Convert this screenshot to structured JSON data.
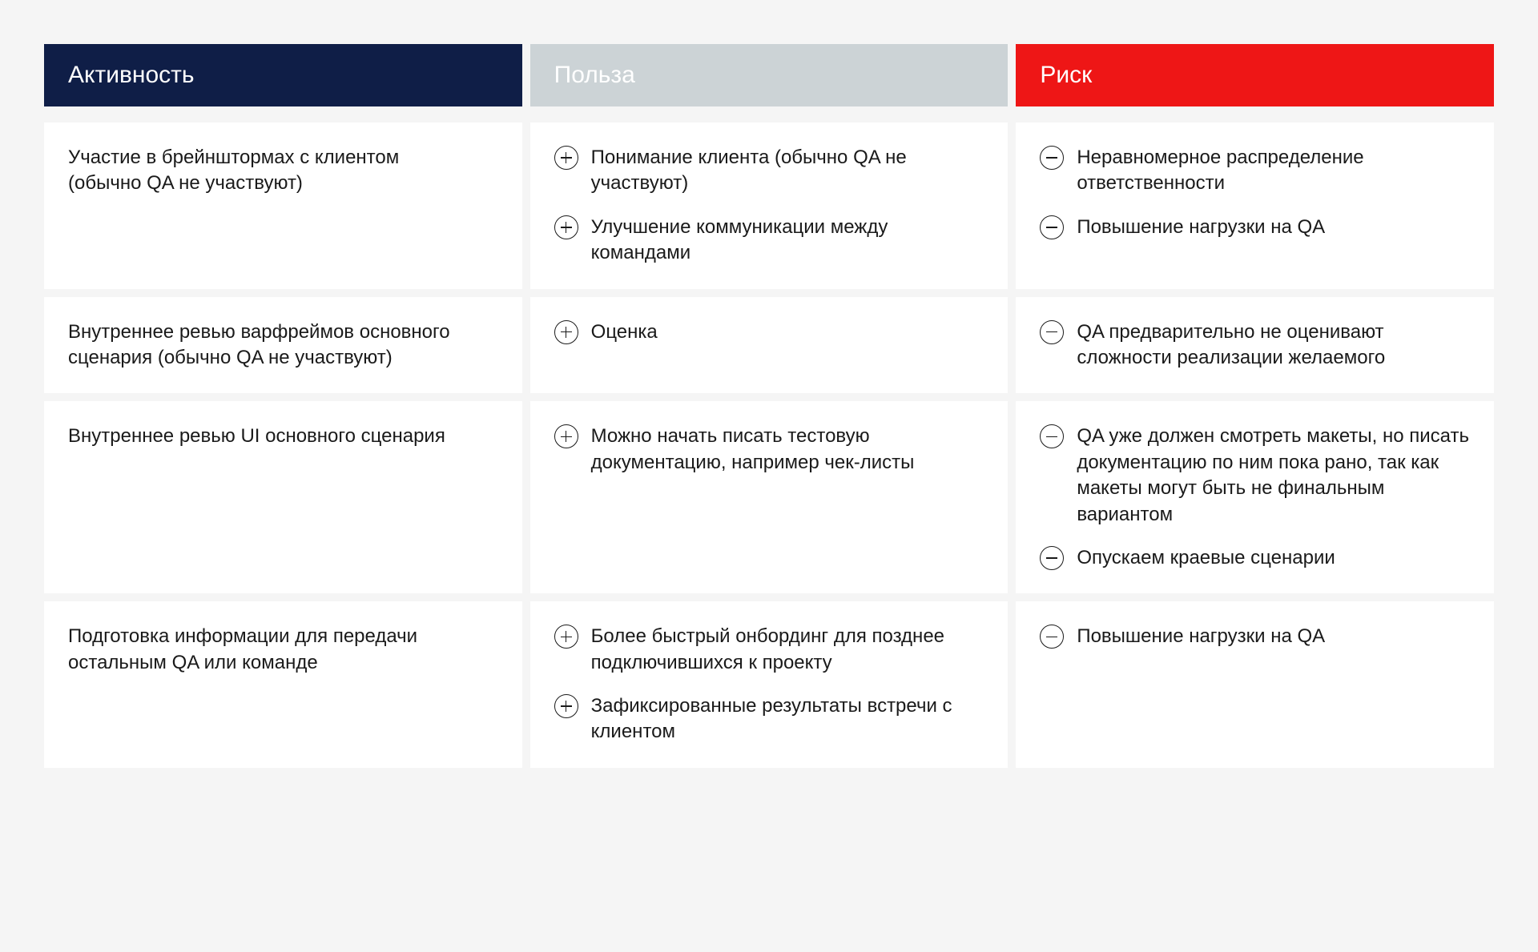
{
  "headers": {
    "activity": "Активность",
    "benefit": "Польза",
    "risk": "Риск"
  },
  "rows": [
    {
      "activity": "Участие в брейнштормах с клиентом (обычно QA не участвуют)",
      "benefits": [
        "Понимание клиента (обычно QA не участвуют)",
        "Улучшение коммуникации между командами"
      ],
      "risks": [
        "Неравномерное распределение ответственности",
        "Повышение нагрузки на QA"
      ]
    },
    {
      "activity": "Внутреннее ревью варфреймов основного сценария (обычно QA не участвуют)",
      "benefits": [
        "Оценка"
      ],
      "risks": [
        "QA предварительно не оценивают сложности реализации желаемого"
      ]
    },
    {
      "activity": "Внутреннее ревью UI основного сценария",
      "benefits": [
        "Можно начать писать тестовую документацию, например чек-листы"
      ],
      "risks": [
        "QA уже должен смотреть макеты, но писать документацию по ним пока рано, так как макеты могут быть не финальным вариантом",
        "Опускаем краевые сценарии"
      ]
    },
    {
      "activity": "Подготовка информации для передачи остальным QA или команде",
      "benefits": [
        "Более быстрый онбординг для позднее подключившихся к проекту",
        "Зафиксированные результаты встречи с клиентом"
      ],
      "risks": [
        "Повышение нагрузки на QA"
      ]
    }
  ]
}
